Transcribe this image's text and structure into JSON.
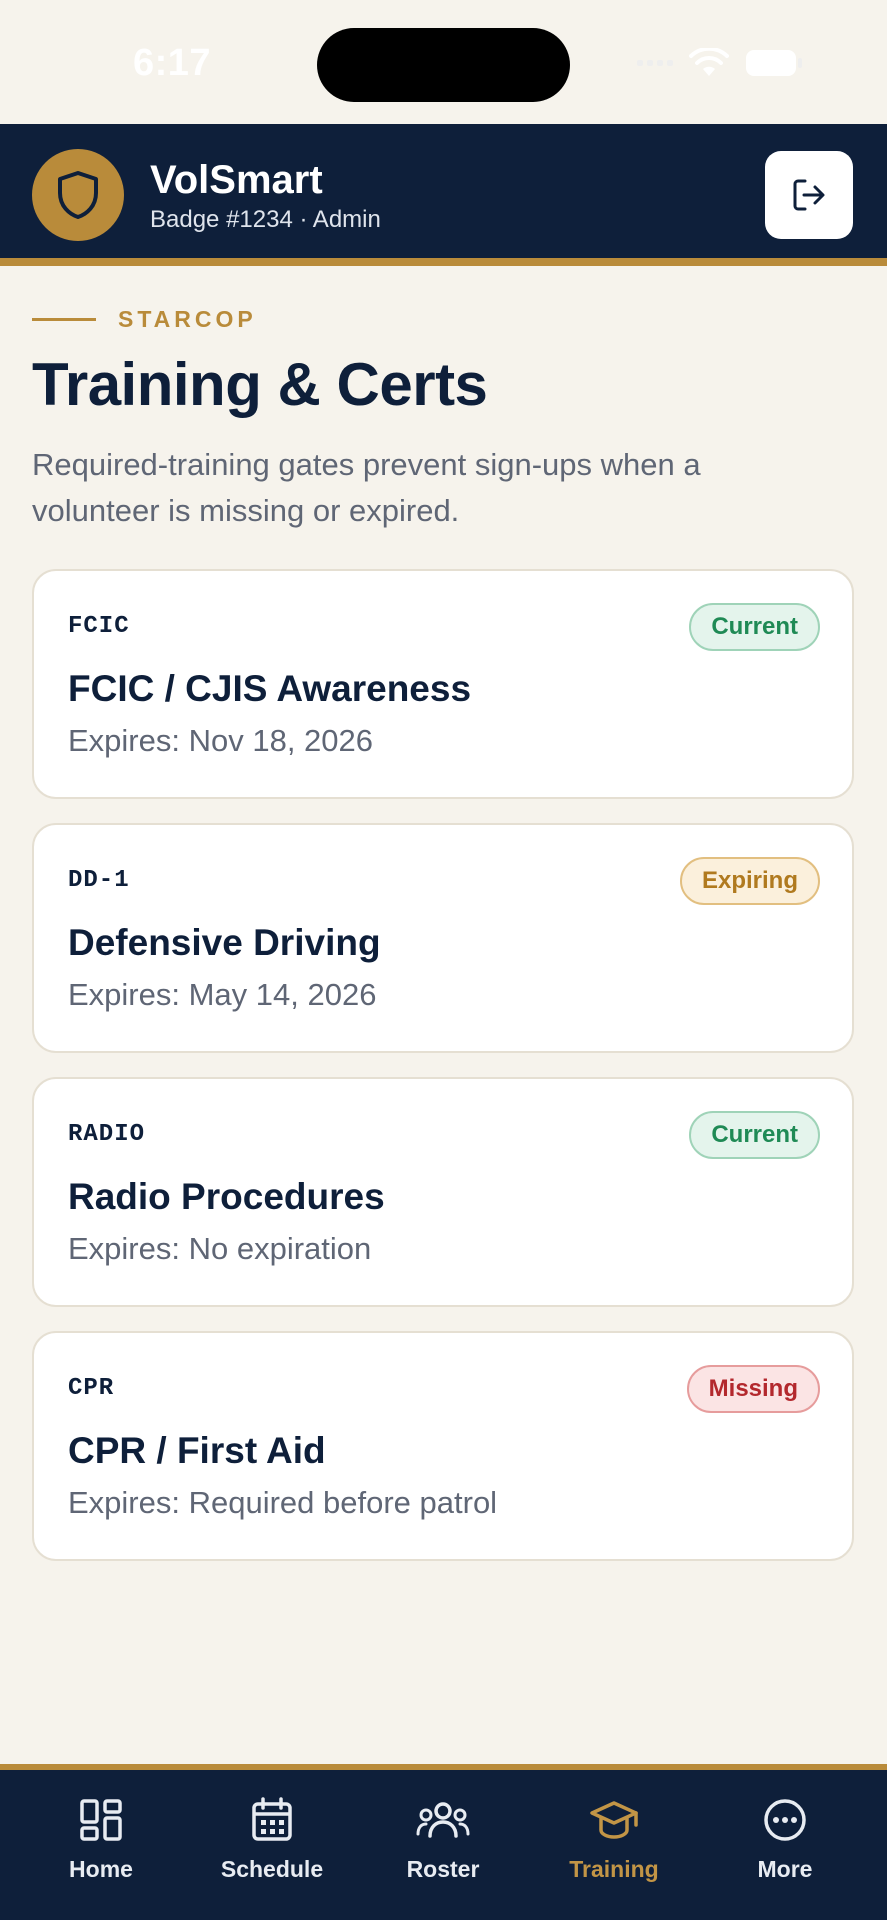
{
  "status_bar": {
    "time": "6:17"
  },
  "header": {
    "app_name": "VolSmart",
    "subtitle": "Badge #1234 · Admin",
    "logo_icon": "shield-icon",
    "logout_icon": "logout-icon"
  },
  "page": {
    "eyebrow": "STARCOP",
    "title": "Training & Certs",
    "description": "Required-training gates prevent sign-ups when a volunteer is missing or expired."
  },
  "certs": [
    {
      "code": "FCIC",
      "title": "FCIC / CJIS Awareness",
      "expiry": "Expires: Nov 18, 2026",
      "status": "Current"
    },
    {
      "code": "DD-1",
      "title": "Defensive Driving",
      "expiry": "Expires: May 14, 2026",
      "status": "Expiring"
    },
    {
      "code": "RADIO",
      "title": "Radio Procedures",
      "expiry": "Expires: No expiration",
      "status": "Current"
    },
    {
      "code": "CPR",
      "title": "CPR / First Aid",
      "expiry": "Expires: Required before patrol",
      "status": "Missing"
    }
  ],
  "nav": {
    "items": [
      {
        "label": "Home",
        "icon": "dashboard-icon"
      },
      {
        "label": "Schedule",
        "icon": "calendar-icon"
      },
      {
        "label": "Roster",
        "icon": "people-icon"
      },
      {
        "label": "Training",
        "icon": "graduation-cap-icon",
        "active": true
      },
      {
        "label": "More",
        "icon": "more-icon"
      }
    ]
  },
  "colors": {
    "navy": "#0e1f3a",
    "gold": "#b98b3a",
    "background": "#f6f3ec",
    "current": "#1f8a55",
    "expiring": "#b07a1f",
    "missing": "#b3282d"
  }
}
